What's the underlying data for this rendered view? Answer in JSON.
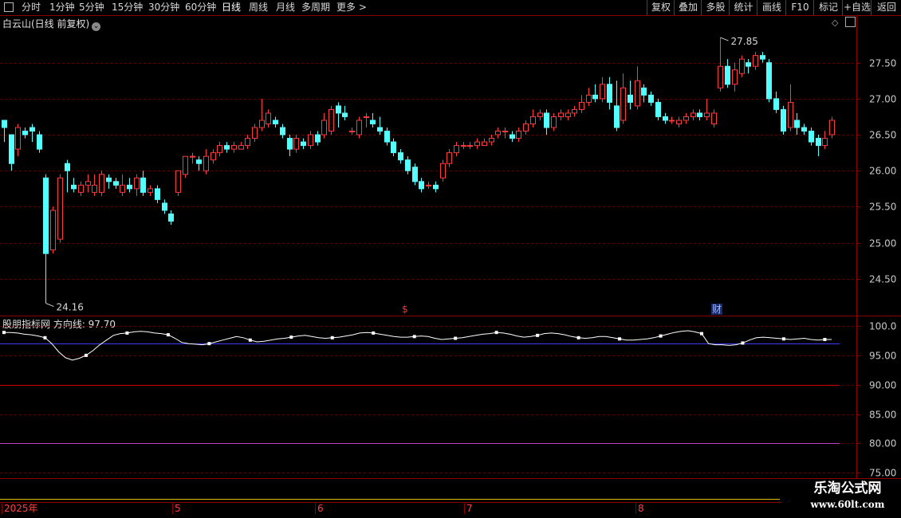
{
  "toolbar": {
    "left_items": [
      "分时",
      "1分钟",
      "5分钟",
      "15分钟",
      "30分钟",
      "60分钟",
      "日线",
      "周线",
      "月线",
      "多周期",
      "更多 >"
    ],
    "active_index": 6,
    "right_items": [
      "复权",
      "叠加",
      "多股",
      "统计",
      "画线",
      "F10",
      "标记",
      "+自选",
      "返回"
    ]
  },
  "chart": {
    "title": "白云山(日线 前复权)",
    "high_label": "27.85",
    "low_label": "24.16",
    "price_ticks": [
      "27.50",
      "27.00",
      "26.50",
      "26.00",
      "25.50",
      "25.00",
      "24.50"
    ],
    "markers": {
      "dividend": "$",
      "finance": "财"
    }
  },
  "indicator": {
    "title": "股朋指标网 方向线: 97.70",
    "ticks": [
      "100.0",
      "95.00",
      "90.00",
      "85.00",
      "80.00",
      "75.00"
    ]
  },
  "timeline": {
    "labels": [
      "2025年",
      "5",
      "6",
      "7",
      "8"
    ]
  },
  "watermark": {
    "line1": "乐淘公式网",
    "line2": "www.60lt.com"
  },
  "colors": {
    "up": "#ff3b3b",
    "down": "#54ffff",
    "grid": "#5a0000",
    "axis": "#8a0000",
    "indicator_line": "#ffffff",
    "blue_line": "#3a3aff",
    "red_line": "#d00000",
    "magenta_line": "#c040c0",
    "yellow_line": "#d8c000"
  },
  "chart_data": {
    "type": "candlestick",
    "price_range": [
      24.0,
      27.95
    ],
    "candles": [
      [
        26.7,
        26.6,
        26.7,
        26.4
      ],
      [
        26.5,
        26.1,
        26.5,
        26.0
      ],
      [
        26.3,
        26.6,
        26.65,
        26.2
      ],
      [
        26.55,
        26.5,
        26.6,
        26.45
      ],
      [
        26.6,
        26.55,
        26.65,
        26.4
      ],
      [
        26.5,
        26.3,
        26.55,
        26.25
      ],
      [
        25.9,
        24.85,
        25.95,
        24.16
      ],
      [
        24.9,
        25.45,
        25.5,
        24.85
      ],
      [
        25.05,
        25.9,
        25.95,
        25.0
      ],
      [
        26.1,
        26.0,
        26.15,
        25.7
      ],
      [
        25.8,
        25.75,
        25.9,
        25.7
      ],
      [
        25.7,
        25.8,
        25.85,
        25.65
      ],
      [
        25.8,
        25.85,
        25.95,
        25.7
      ],
      [
        25.7,
        25.8,
        25.95,
        25.65
      ],
      [
        25.7,
        25.95,
        26.0,
        25.65
      ],
      [
        25.9,
        25.85,
        25.95,
        25.75
      ],
      [
        25.85,
        25.8,
        25.9,
        25.75
      ],
      [
        25.7,
        25.8,
        25.95,
        25.65
      ],
      [
        25.8,
        25.75,
        25.9,
        25.7
      ],
      [
        25.75,
        25.9,
        25.95,
        25.65
      ],
      [
        25.9,
        25.7,
        26.0,
        25.65
      ],
      [
        25.7,
        25.75,
        25.8,
        25.65
      ],
      [
        25.75,
        25.6,
        25.8,
        25.55
      ],
      [
        25.55,
        25.45,
        25.6,
        25.4
      ],
      [
        25.4,
        25.3,
        25.45,
        25.25
      ],
      [
        25.7,
        26.0,
        26.0,
        25.65
      ],
      [
        25.95,
        26.2,
        26.2,
        25.9
      ],
      [
        26.2,
        26.2,
        26.25,
        26.1
      ],
      [
        26.15,
        26.1,
        26.2,
        26.0
      ],
      [
        26.0,
        26.2,
        26.3,
        25.95
      ],
      [
        26.15,
        26.25,
        26.3,
        26.1
      ],
      [
        26.25,
        26.35,
        26.4,
        26.2
      ],
      [
        26.35,
        26.3,
        26.4,
        26.25
      ],
      [
        26.3,
        26.35,
        26.4,
        26.25
      ],
      [
        26.3,
        26.35,
        26.4,
        26.3
      ],
      [
        26.35,
        26.45,
        26.5,
        26.3
      ],
      [
        26.45,
        26.6,
        26.65,
        26.4
      ],
      [
        26.6,
        26.7,
        27.0,
        26.55
      ],
      [
        26.65,
        26.8,
        26.85,
        26.6
      ],
      [
        26.7,
        26.65,
        26.75,
        26.6
      ],
      [
        26.6,
        26.5,
        26.65,
        26.45
      ],
      [
        26.45,
        26.3,
        26.5,
        26.2
      ],
      [
        26.3,
        26.45,
        26.5,
        26.25
      ],
      [
        26.4,
        26.35,
        26.45,
        26.3
      ],
      [
        26.35,
        26.5,
        26.55,
        26.3
      ],
      [
        26.5,
        26.4,
        26.55,
        26.35
      ],
      [
        26.5,
        26.7,
        26.8,
        26.45
      ],
      [
        26.55,
        26.85,
        26.9,
        26.5
      ],
      [
        26.9,
        26.8,
        26.95,
        26.6
      ],
      [
        26.8,
        26.75,
        26.9,
        26.7
      ],
      [
        26.55,
        26.55,
        26.6,
        26.5
      ],
      [
        26.5,
        26.7,
        26.75,
        26.45
      ],
      [
        26.75,
        26.75,
        26.8,
        26.6
      ],
      [
        26.7,
        26.65,
        26.8,
        26.6
      ],
      [
        26.6,
        26.55,
        26.75,
        26.5
      ],
      [
        26.55,
        26.4,
        26.6,
        26.35
      ],
      [
        26.4,
        26.25,
        26.45,
        26.2
      ],
      [
        26.25,
        26.15,
        26.3,
        26.1
      ],
      [
        26.15,
        26.0,
        26.2,
        25.95
      ],
      [
        26.05,
        25.85,
        26.1,
        25.8
      ],
      [
        25.85,
        25.75,
        25.9,
        25.7
      ],
      [
        25.8,
        25.8,
        25.85,
        25.75
      ],
      [
        25.8,
        25.75,
        25.85,
        25.7
      ],
      [
        25.9,
        26.1,
        26.15,
        25.85
      ],
      [
        26.1,
        26.25,
        26.3,
        26.05
      ],
      [
        26.25,
        26.35,
        26.4,
        26.2
      ],
      [
        26.35,
        26.35,
        26.4,
        26.3
      ],
      [
        26.35,
        26.35,
        26.4,
        26.3
      ],
      [
        26.35,
        26.4,
        26.45,
        26.3
      ],
      [
        26.35,
        26.4,
        26.45,
        26.35
      ],
      [
        26.4,
        26.45,
        26.5,
        26.35
      ],
      [
        26.5,
        26.55,
        26.6,
        26.45
      ],
      [
        26.55,
        26.55,
        26.6,
        26.45
      ],
      [
        26.5,
        26.45,
        26.55,
        26.4
      ],
      [
        26.45,
        26.55,
        26.6,
        26.4
      ],
      [
        26.55,
        26.65,
        26.7,
        26.5
      ],
      [
        26.65,
        26.75,
        26.85,
        26.6
      ],
      [
        26.75,
        26.8,
        26.85,
        26.7
      ],
      [
        26.8,
        26.6,
        26.85,
        26.5
      ],
      [
        26.6,
        26.75,
        26.8,
        26.55
      ],
      [
        26.75,
        26.8,
        26.85,
        26.7
      ],
      [
        26.75,
        26.8,
        26.85,
        26.7
      ],
      [
        26.8,
        26.85,
        26.9,
        26.75
      ],
      [
        26.85,
        26.95,
        27.05,
        26.8
      ],
      [
        26.95,
        27.05,
        27.15,
        26.9
      ],
      [
        27.05,
        27.0,
        27.2,
        26.95
      ],
      [
        27.0,
        27.2,
        27.3,
        26.95
      ],
      [
        27.2,
        26.95,
        27.3,
        26.85
      ],
      [
        26.9,
        26.6,
        27.25,
        26.55
      ],
      [
        26.7,
        27.15,
        27.35,
        26.65
      ],
      [
        27.05,
        26.95,
        27.25,
        26.85
      ],
      [
        26.9,
        27.25,
        27.45,
        26.85
      ],
      [
        27.15,
        27.05,
        27.2,
        26.95
      ],
      [
        27.05,
        26.95,
        27.1,
        26.9
      ],
      [
        26.95,
        26.75,
        27.0,
        26.7
      ],
      [
        26.75,
        26.7,
        26.8,
        26.65
      ],
      [
        26.7,
        26.7,
        26.75,
        26.65
      ],
      [
        26.65,
        26.7,
        26.75,
        26.6
      ],
      [
        26.7,
        26.75,
        26.8,
        26.65
      ],
      [
        26.75,
        26.8,
        26.85,
        26.7
      ],
      [
        26.8,
        26.75,
        26.85,
        26.7
      ],
      [
        26.75,
        26.8,
        27.0,
        26.7
      ],
      [
        26.65,
        26.8,
        26.85,
        26.6
      ],
      [
        27.15,
        27.45,
        27.85,
        27.1
      ],
      [
        27.45,
        27.2,
        27.55,
        27.15
      ],
      [
        27.2,
        27.4,
        27.5,
        27.1
      ],
      [
        27.35,
        27.55,
        27.6,
        27.3
      ],
      [
        27.5,
        27.45,
        27.55,
        27.35
      ],
      [
        27.45,
        27.6,
        27.65,
        27.4
      ],
      [
        27.6,
        27.55,
        27.65,
        27.5
      ],
      [
        27.5,
        27.0,
        27.55,
        26.95
      ],
      [
        27.0,
        26.85,
        27.1,
        26.8
      ],
      [
        26.85,
        26.55,
        26.9,
        26.5
      ],
      [
        26.6,
        26.95,
        27.2,
        26.55
      ],
      [
        26.7,
        26.6,
        26.8,
        26.5
      ],
      [
        26.6,
        26.55,
        26.65,
        26.5
      ],
      [
        26.55,
        26.4,
        26.6,
        26.35
      ],
      [
        26.45,
        26.35,
        26.5,
        26.2
      ],
      [
        26.35,
        26.45,
        26.55,
        26.3
      ],
      [
        26.5,
        26.7,
        26.75,
        26.45
      ]
    ],
    "indicator": {
      "name": "方向线",
      "last_value": 97.7,
      "range": [
        74.5,
        101.5
      ],
      "values": [
        98.9,
        98.9,
        98.8,
        98.6,
        98.5,
        98.3,
        98.0,
        97.0,
        95.6,
        94.6,
        94.2,
        94.5,
        95.0,
        95.8,
        96.8,
        97.6,
        98.4,
        98.7,
        98.8,
        99.0,
        99.1,
        99.0,
        98.8,
        98.7,
        98.5,
        97.9,
        97.2,
        97.0,
        96.9,
        96.8,
        97.0,
        97.3,
        97.6,
        97.9,
        98.2,
        98.0,
        97.6,
        97.3,
        97.4,
        97.6,
        97.8,
        97.9,
        98.1,
        98.3,
        98.4,
        98.2,
        98.0,
        97.9,
        98.0,
        98.1,
        98.3,
        98.5,
        98.8,
        98.9,
        98.8,
        98.6,
        98.4,
        98.2,
        98.1,
        98.1,
        98.2,
        98.3,
        98.2,
        97.9,
        97.7,
        97.8,
        97.9,
        98.0,
        98.2,
        98.4,
        98.6,
        98.7,
        98.9,
        98.8,
        98.6,
        98.3,
        98.1,
        98.2,
        98.4,
        98.7,
        98.8,
        98.7,
        98.5,
        98.2,
        98.0,
        97.9,
        98.0,
        98.2,
        98.2,
        98.0,
        97.8,
        97.6,
        97.6,
        97.7,
        97.8,
        98.0,
        98.3,
        98.6,
        98.9,
        99.1,
        99.2,
        99.0,
        98.7,
        97.0,
        96.8,
        96.8,
        96.7,
        96.8,
        97.1,
        97.6,
        98.0,
        98.1,
        98.0,
        97.9,
        97.8,
        97.7,
        97.8,
        97.9,
        97.7,
        97.6,
        97.7,
        97.7
      ],
      "reference_lines": [
        97.0,
        90.0,
        80.0
      ]
    }
  }
}
